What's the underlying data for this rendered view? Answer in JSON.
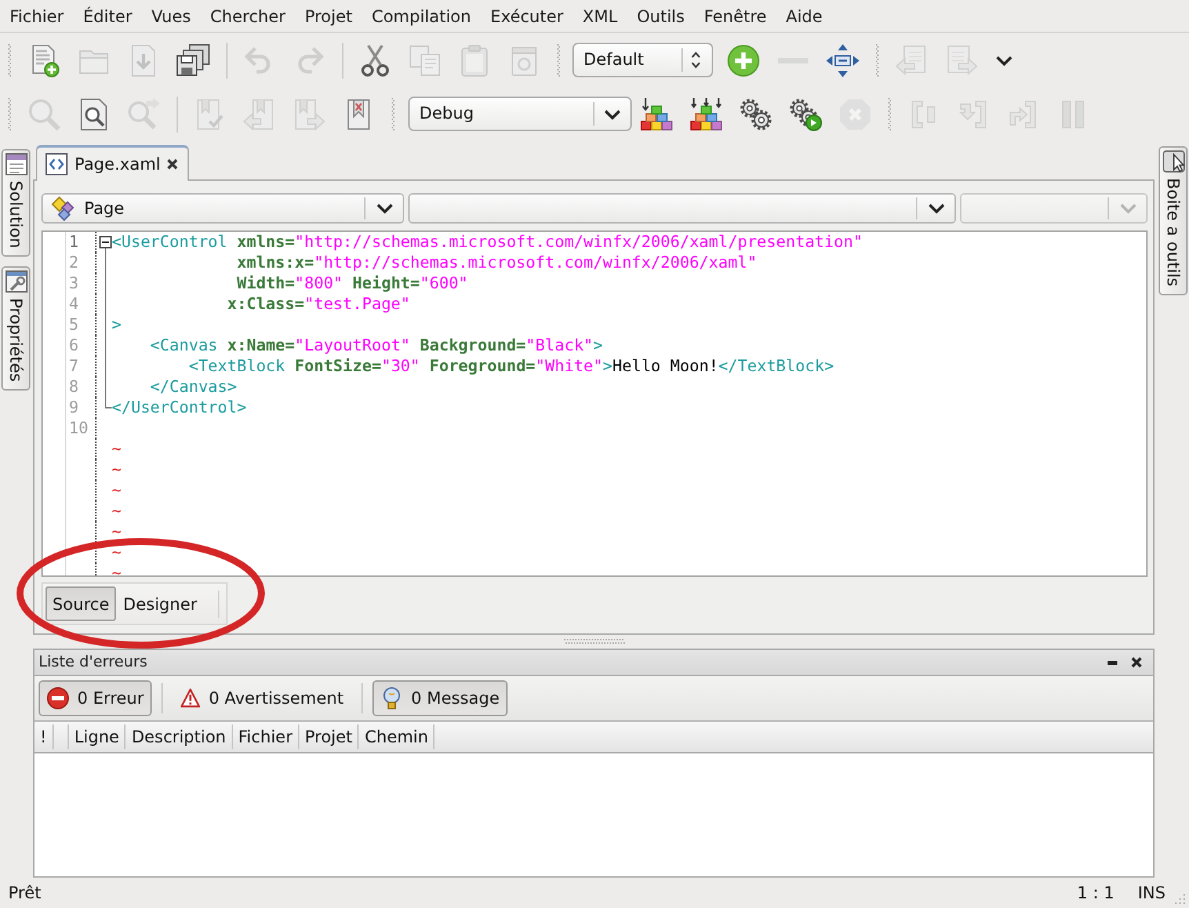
{
  "menu": [
    {
      "label": "Fichier"
    },
    {
      "label": "Éditer"
    },
    {
      "label": "Vues"
    },
    {
      "label": "Chercher"
    },
    {
      "label": "Projet"
    },
    {
      "label": "Compilation"
    },
    {
      "label": "Exécuter"
    },
    {
      "label": "XML"
    },
    {
      "label": "Outils"
    },
    {
      "label": "Fenêtre"
    },
    {
      "label": "Aide"
    }
  ],
  "toolbars": [
    {
      "items": [
        {
          "kind": "grip"
        },
        {
          "kind": "button",
          "disabled": false
        },
        {
          "kind": "button",
          "disabled": true
        },
        {
          "kind": "button",
          "disabled": true
        },
        {
          "kind": "button",
          "disabled": false
        },
        {
          "kind": "separator"
        },
        {
          "kind": "button",
          "disabled": true
        },
        {
          "kind": "button",
          "disabled": true
        },
        {
          "kind": "separator"
        },
        {
          "kind": "button",
          "disabled": false
        },
        {
          "kind": "button",
          "disabled": true
        },
        {
          "kind": "button",
          "disabled": true
        },
        {
          "kind": "button",
          "disabled": true
        },
        {
          "kind": "grip"
        },
        {
          "kind": "spin_combo",
          "value": "Default"
        },
        {
          "kind": "button",
          "disabled": false
        },
        {
          "kind": "button",
          "disabled": true
        },
        {
          "kind": "button",
          "disabled": false
        },
        {
          "kind": "grip"
        },
        {
          "kind": "button",
          "disabled": true
        },
        {
          "kind": "button",
          "disabled": true
        },
        {
          "kind": "overflow"
        }
      ]
    },
    {
      "items": [
        {
          "kind": "grip"
        },
        {
          "kind": "button",
          "disabled": true
        },
        {
          "kind": "button",
          "disabled": false
        },
        {
          "kind": "button",
          "disabled": true
        },
        {
          "kind": "separator"
        },
        {
          "kind": "button",
          "disabled": true
        },
        {
          "kind": "button",
          "disabled": true
        },
        {
          "kind": "button",
          "disabled": true
        },
        {
          "kind": "button",
          "disabled": false
        },
        {
          "kind": "grip"
        },
        {
          "kind": "combo",
          "value": "Debug"
        },
        {
          "kind": "button",
          "disabled": false
        },
        {
          "kind": "button",
          "disabled": false
        },
        {
          "kind": "button",
          "disabled": false
        },
        {
          "kind": "button",
          "disabled": false
        },
        {
          "kind": "button",
          "disabled": true
        },
        {
          "kind": "grip"
        },
        {
          "kind": "button",
          "disabled": true
        },
        {
          "kind": "button",
          "disabled": true
        },
        {
          "kind": "button",
          "disabled": true
        },
        {
          "kind": "button",
          "disabled": true
        }
      ]
    }
  ],
  "left_pads": [
    {
      "label": "Solution"
    },
    {
      "label": "Propriétés"
    }
  ],
  "document_tab": {
    "label": "Page.xaml",
    "selected": true
  },
  "member_bar": [
    {
      "value": "Page",
      "disabled": false
    },
    {
      "disabled": false
    },
    {
      "disabled": true
    }
  ],
  "code_lines": [
    {
      "kind": "foldstart",
      "number": "1",
      "current": true,
      "tokens": [
        {
          "kind": "tag",
          "text": "<UserControl"
        },
        {
          "kind": "attr",
          "text": " xmlns="
        },
        {
          "kind": "string",
          "text": "\"http://schemas.microsoft.com/winfx/2006/xaml/presentation\""
        }
      ]
    },
    {
      "kind": "folded",
      "number": "2",
      "current": false,
      "tokens": [
        {
          "kind": "attr",
          "text": "             xmlns:x="
        },
        {
          "kind": "string",
          "text": "\"http://schemas.microsoft.com/winfx/2006/xaml\""
        }
      ]
    },
    {
      "kind": "folded",
      "number": "3",
      "current": false,
      "tokens": [
        {
          "kind": "attr",
          "text": "             Width="
        },
        {
          "kind": "string",
          "text": "\"800\""
        },
        {
          "kind": "attr",
          "text": " Height="
        },
        {
          "kind": "string",
          "text": "\"600\""
        }
      ]
    },
    {
      "kind": "folded",
      "number": "4",
      "current": false,
      "tokens": [
        {
          "kind": "attr",
          "text": "            x:Class="
        },
        {
          "kind": "string",
          "text": "\"test.Page\""
        }
      ]
    },
    {
      "kind": "folded",
      "number": "5",
      "current": false,
      "tokens": [
        {
          "kind": "tag",
          "text": ">"
        }
      ]
    },
    {
      "kind": "folded",
      "number": "6",
      "current": false,
      "tokens": [
        {
          "kind": "tag",
          "text": "    <Canvas"
        },
        {
          "kind": "attr",
          "text": " x:Name="
        },
        {
          "kind": "string",
          "text": "\"LayoutRoot\""
        },
        {
          "kind": "attr",
          "text": " Background="
        },
        {
          "kind": "string",
          "text": "\"Black\""
        },
        {
          "kind": "tag",
          "text": ">"
        }
      ]
    },
    {
      "kind": "folded",
      "number": "7",
      "current": false,
      "tokens": [
        {
          "kind": "tag",
          "text": "        <TextBlock"
        },
        {
          "kind": "attr",
          "text": " FontSize="
        },
        {
          "kind": "string",
          "text": "\"30\""
        },
        {
          "kind": "attr",
          "text": " Foreground="
        },
        {
          "kind": "string",
          "text": "\"White\""
        },
        {
          "kind": "tag",
          "text": ">"
        },
        {
          "kind": "text",
          "text": "Hello Moon!"
        },
        {
          "kind": "tag",
          "text": "</TextBlock>"
        }
      ]
    },
    {
      "kind": "folded",
      "number": "8",
      "current": false,
      "tokens": [
        {
          "kind": "tag",
          "text": "    </Canvas>"
        }
      ]
    },
    {
      "kind": "foldend",
      "number": "9",
      "current": false,
      "tokens": [
        {
          "kind": "tag",
          "text": "</UserControl>"
        }
      ]
    },
    {
      "kind": "plain",
      "number": "10",
      "current": false
    }
  ],
  "filler_lines": [
    "~",
    "~",
    "~",
    "~",
    "~",
    "~",
    "~"
  ],
  "view_tabs": [
    {
      "label": "Source",
      "selected": true
    },
    {
      "label": "Designer",
      "selected": false
    }
  ],
  "error_list": {
    "title": "Liste d'erreurs",
    "filters": [
      {
        "kind": "error",
        "label": "0 Erreur",
        "selected": true
      },
      {
        "kind": "warning",
        "label": "0 Avertissement",
        "selected": false
      },
      {
        "kind": "message",
        "label": "0 Message",
        "selected": true
      }
    ],
    "columns": [
      {
        "kind": "text",
        "label": "!"
      },
      {
        "kind": "blank"
      },
      {
        "kind": "text",
        "label": "Ligne"
      },
      {
        "kind": "text",
        "label": "Description"
      },
      {
        "kind": "text",
        "label": "Fichier"
      },
      {
        "kind": "text",
        "label": "Projet"
      },
      {
        "kind": "text",
        "label": "Chemin"
      }
    ]
  },
  "right_pads": [
    {
      "label": "Boite a outils"
    }
  ],
  "status_bar": {
    "message": "Prêt",
    "position": "1 : 1",
    "mode": "INS"
  },
  "annotation": {
    "kind": "ellipse"
  }
}
